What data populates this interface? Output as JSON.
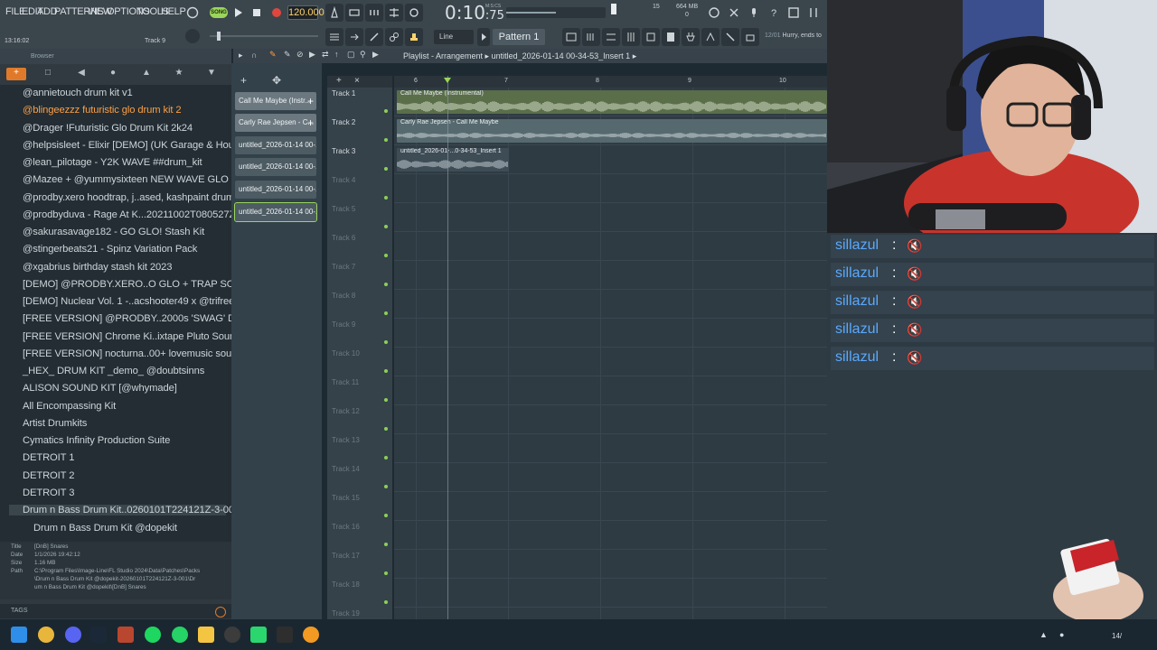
{
  "menu": [
    "FILE",
    "EDIT",
    "ADD",
    "PATTERNS",
    "VIEW",
    "OPTIONS",
    "TOOLS",
    "HELP"
  ],
  "transport": {
    "song_label": "SONG",
    "bpm": "120.000",
    "time_main": "0:10",
    "time_frac": ":75",
    "time_unit": "M:S:CS",
    "cpu": "15",
    "mem": "664 MB",
    "mem_sub": "0"
  },
  "toolbar": {
    "snap": "Line",
    "pattern": "Pattern 1",
    "hint_num": "12/01",
    "hint_text": "Hurry, ends to"
  },
  "status": {
    "clock": "13:16:02",
    "track_hint": "Track 9"
  },
  "browser": {
    "title": "Browser",
    "items": [
      {
        "label": "@annietouch drum kit v1",
        "style": ""
      },
      {
        "label": "@blingeezzz futuristic glo drum kit 2",
        "style": "hl"
      },
      {
        "label": "@Drager !Futuristic Glo Drum Kit 2k24",
        "style": ""
      },
      {
        "label": "@helpsisleet - Elixir [DEMO] (UK Garage & House)",
        "style": ""
      },
      {
        "label": "@lean_pilotage - Y2K WAVE ##drum_kit",
        "style": ""
      },
      {
        "label": "@Mazee + @yummysixteen NEW WAVE GLO kit",
        "style": ""
      },
      {
        "label": "@prodby.xero hoodtrap, j..ased, kashpaint drum kit",
        "style": ""
      },
      {
        "label": "@prodbyduva - Rage At K...20211002T080527Z-001",
        "style": ""
      },
      {
        "label": "@sakurasavage182 - GO GLO! Stash Kit",
        "style": ""
      },
      {
        "label": "@stingerbeats21 - Spinz Variation Pack",
        "style": ""
      },
      {
        "label": "@xgabrius birthday stash kit 2023",
        "style": ""
      },
      {
        "label": "[DEMO] @PRODBY.XERO..O GLO + TRAP SOUND KIT",
        "style": ""
      },
      {
        "label": "[DEMO] Nuclear Vol. 1 -..acshooter49 x @trifreeze",
        "style": ""
      },
      {
        "label": "[FREE VERSION] @PRODBY..2000s 'SWAG' Drum Kit",
        "style": ""
      },
      {
        "label": "[FREE VERSION] Chrome Ki..ixtape Pluto Sound Kit",
        "style": ""
      },
      {
        "label": "[FREE VERSION] nocturna..00+ lovemusic sound kit",
        "style": ""
      },
      {
        "label": "_HEX_ DRUM KIT _demo_ @doubtsinns",
        "style": ""
      },
      {
        "label": "ALISON SOUND KIT [@whymade]",
        "style": ""
      },
      {
        "label": "All Encompassing Kit",
        "style": ""
      },
      {
        "label": "Artist Drumkits",
        "style": ""
      },
      {
        "label": "Cymatics Infinity Production Suite",
        "style": ""
      },
      {
        "label": "DETROIT 1",
        "style": ""
      },
      {
        "label": "DETROIT 2",
        "style": ""
      },
      {
        "label": "DETROIT 3",
        "style": ""
      },
      {
        "label": "Drum n Bass Drum Kit..0260101T224121Z-3-001",
        "style": "sel"
      },
      {
        "label": "Drum n Bass Drum Kit @dopekit",
        "style": "child"
      }
    ],
    "info": {
      "title_k": "Title",
      "title_v": "[DnB] Snares",
      "date_k": "Date",
      "date_v": "1/1/2026 19:42:12",
      "size_k": "Size",
      "size_v": "1.16 MB",
      "path_k": "Path",
      "path_1": "C:\\Program Files\\Image-Line\\FL Studio 2024\\Data\\Patches\\Packs",
      "path_2": "\\Drum n Bass Drum Kit @dopekit-20260101T224121Z-3-001\\Dr",
      "path_3": "um n Bass Drum Kit @dopekit\\[DnB] Snares"
    },
    "tags": "TAGS"
  },
  "picker": [
    {
      "label": "Call Me Maybe (Instr...",
      "kind": "pat"
    },
    {
      "label": "Carly Rae Jepsen - C...",
      "kind": "pat"
    },
    {
      "label": "untitled_2026-01-14 00-...",
      "kind": "audio"
    },
    {
      "label": "untitled_2026-01-14 00-...",
      "kind": "audio"
    },
    {
      "label": "untitled_2026-01-14 00-...",
      "kind": "audio"
    },
    {
      "label": "untitled_2026-01-14 00-...",
      "kind": "audio-sel"
    }
  ],
  "playlist": {
    "title": "Playlist - Arrangement",
    "arrangement": "untitled_2026-01-14 00-34-53_Insert 1",
    "ruler": [
      "6",
      "7",
      "8",
      "9",
      "10"
    ],
    "tracks": [
      "Track 1",
      "Track 2",
      "Track 3",
      "Track 4",
      "Track 5",
      "Track 6",
      "Track 7",
      "Track 8",
      "Track 9",
      "Track 10",
      "Track 11",
      "Track 12",
      "Track 13",
      "Track 14",
      "Track 15",
      "Track 16",
      "Track 17",
      "Track 18",
      "Track 19"
    ],
    "clips": [
      {
        "label": "Call Me Maybe (Instrumental)"
      },
      {
        "label": "Carly Rae Jepsen - Call Me Maybe"
      },
      {
        "label": "untitled_2026-01-...0-34-53_Insert 1"
      }
    ]
  },
  "chat": {
    "rows": [
      {
        "name": "sillazul",
        "sep": ":"
      },
      {
        "name": "sillazul",
        "sep": ":"
      },
      {
        "name": "sillazul",
        "sep": ":"
      },
      {
        "name": "sillazul",
        "sep": ":"
      },
      {
        "name": "sillazul",
        "sep": ":"
      }
    ]
  },
  "taskbar": {
    "tray_time": "14/"
  },
  "colors": {
    "accent": "#e07a2a",
    "highlight_text": "#ff9e45",
    "song_green": "#9ad65a",
    "chat_name": "#5aa9ff"
  }
}
